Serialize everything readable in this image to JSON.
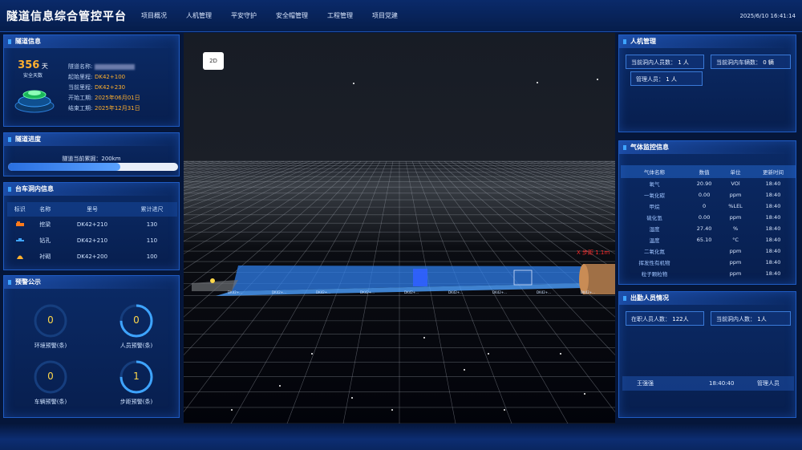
{
  "app_title": "隧道信息综合管控平台",
  "nav": [
    "项目概况",
    "人机管理",
    "平安守护",
    "安全帽管理",
    "工程管理",
    "项目党建"
  ],
  "clock": "2025/6/10 16:41:14",
  "tunnel_info": {
    "title": "隧道信息",
    "days": "356",
    "days_unit": "天",
    "days_label": "安全天数",
    "rows": [
      {
        "k": "隧道名称:",
        "v": ""
      },
      {
        "k": "起始里程:",
        "v": "DK42+100"
      },
      {
        "k": "当前里程:",
        "v": "DK42+230"
      },
      {
        "k": "开始工期:",
        "v": "2025年06月01日"
      },
      {
        "k": "结束工期:",
        "v": "2025年12月31日"
      }
    ]
  },
  "progress": {
    "title": "隧道进度",
    "label": "隧道当前累掘：200km",
    "fill_percent": 66
  },
  "vehicles": {
    "title": "台车洞内信息",
    "headers": [
      "标识",
      "名称",
      "里号",
      "累计进尺"
    ],
    "rows": [
      {
        "name": "挖梁",
        "mile": "DK42+210",
        "total": "130",
        "icon_color": "#ff7a1a"
      },
      {
        "name": "钻孔",
        "mile": "DK42+210",
        "total": "110",
        "icon_color": "#3ea4ff"
      },
      {
        "name": "衬砌",
        "mile": "DK42+200",
        "total": "100",
        "icon_color": "#ffb02e"
      }
    ]
  },
  "warnings": {
    "title": "预警公示",
    "items": [
      {
        "value": "0",
        "label": "环境预警(条)",
        "fill": 0
      },
      {
        "value": "0",
        "label": "人员预警(条)",
        "fill": 0.75
      },
      {
        "value": "0",
        "label": "车辆预警(条)",
        "fill": 0
      },
      {
        "value": "1",
        "label": "步距预警(条)",
        "fill": 0.75
      }
    ]
  },
  "scene": {
    "btn_2d": "2D",
    "marker_label": "X 步距 1.1m",
    "ticks": [
      "DK42+...",
      "DK42+...",
      "DK42+...",
      "DK42+...",
      "DK42+...",
      "DK42+...",
      "DK42+...",
      "DK42+...",
      "DK42+..."
    ]
  },
  "people": {
    "title": "人机管理",
    "inside_label": "当前洞内人员数：",
    "inside_value": "1 人",
    "vehicle_label": "当前洞内车辆数：",
    "vehicle_value": "0 辆",
    "mgr_label": "管理人员：",
    "mgr_value": "1 人"
  },
  "gas": {
    "title": "气体监控信息",
    "headers": [
      "气体名称",
      "数值",
      "单位",
      "更新时间"
    ],
    "rows": [
      {
        "name": "氧气",
        "value": "20.90",
        "unit": "VOl",
        "time": "18:40"
      },
      {
        "name": "一氧化碳",
        "value": "0.00",
        "unit": "ppm",
        "time": "18:40"
      },
      {
        "name": "甲烷",
        "value": "0",
        "unit": "%LEL",
        "time": "18:40"
      },
      {
        "name": "硫化氢",
        "value": "0.00",
        "unit": "ppm",
        "time": "18:40"
      },
      {
        "name": "湿度",
        "value": "27.40",
        "unit": "%",
        "time": "18:40"
      },
      {
        "name": "温度",
        "value": "65.10",
        "unit": "°C",
        "time": "18:40"
      },
      {
        "name": "二氧化氮",
        "value": "",
        "unit": "ppm",
        "time": "18:40"
      },
      {
        "name": "挥发性有机物",
        "value": "",
        "unit": "ppm",
        "time": "18:40"
      },
      {
        "name": "粒子颗粒物",
        "value": "",
        "unit": "ppm",
        "time": "18:40"
      }
    ]
  },
  "attendance": {
    "title": "出勤人员情况",
    "total_label": "在职人员人数：",
    "total_value": "122人",
    "inside_label": "当前洞内人数：",
    "inside_value": "1人",
    "row": {
      "name": "王强强",
      "time": "18:40:40",
      "role": "管理人员"
    }
  }
}
